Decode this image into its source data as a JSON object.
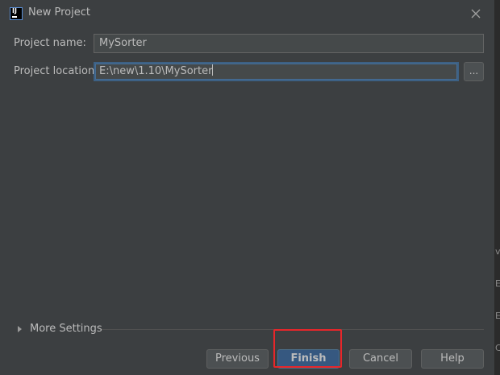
{
  "dialog": {
    "title": "New Project",
    "close_icon": "close-icon"
  },
  "form": {
    "project_name_label": "Project name:",
    "project_name_value": "MySorter",
    "project_location_label": "Project location:",
    "project_location_value": "E:\\new\\1.10\\MySorter",
    "browse_label": "..."
  },
  "more_settings": {
    "label": "More Settings",
    "icon": "expand-triangle-icon"
  },
  "buttons": {
    "previous": "Previous",
    "finish": "Finish",
    "cancel": "Cancel",
    "help": "Help"
  },
  "background": {
    "edge_glyphs": [
      "v",
      "E",
      "E",
      "C"
    ]
  },
  "colors": {
    "dialog_bg": "#3c3f41",
    "focus_border": "#3d6185",
    "default_button": "#365880",
    "highlight": "#e8262a"
  }
}
